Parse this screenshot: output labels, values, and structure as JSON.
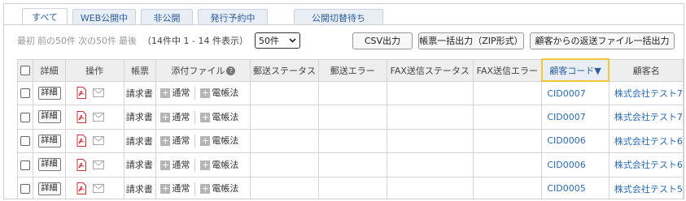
{
  "tabs": [
    {
      "label": "すべて",
      "active": true
    },
    {
      "label": "WEB公開中",
      "active": false
    },
    {
      "label": "非公開",
      "active": false
    },
    {
      "label": "発行予約中",
      "active": false
    },
    {
      "label": "公開切替待ち",
      "active": false
    }
  ],
  "pager": {
    "first": "最初",
    "prev": "前の50件",
    "next": "次の50件",
    "last": "最後",
    "range": "（14件中 1 - 14 件表示）",
    "page_size": "50件"
  },
  "buttons": {
    "csv": "CSV出力",
    "zip": "帳票一括出力（ZIP形式）",
    "returned": "顧客からの返送ファイル一括出力"
  },
  "columns": {
    "detail": "詳細",
    "ops": "操作",
    "form": "帳票",
    "attachments": "添付ファイル",
    "mail_status": "郵送ステータス",
    "mail_error": "郵送エラー",
    "fax_status": "FAX送信ステータス",
    "fax_error": "FAX送信エラー",
    "customer_code": "顧客コード▼",
    "customer_name": "顧客名"
  },
  "row_labels": {
    "detail_button": "詳細",
    "normal": "通常",
    "denchoho": "電帳法"
  },
  "rows": [
    {
      "form": "請求書",
      "code": "CID0007",
      "name": "株式会社テスト7"
    },
    {
      "form": "請求書",
      "code": "CID0007",
      "name": "株式会社テスト7"
    },
    {
      "form": "請求書",
      "code": "CID0006",
      "name": "株式会社テスト6"
    },
    {
      "form": "請求書",
      "code": "CID0006",
      "name": "株式会社テスト6"
    },
    {
      "form": "請求書",
      "code": "CID0005",
      "name": "株式会社テスト5"
    }
  ],
  "icons": [
    "pdf-icon",
    "envelope-icon",
    "help-circle-icon",
    "plus-icon",
    "chevron-down-icon"
  ],
  "colors": {
    "accent": "#2a5d9e",
    "link": "#2a6ab5",
    "sort_highlight": "#f2c63a"
  }
}
